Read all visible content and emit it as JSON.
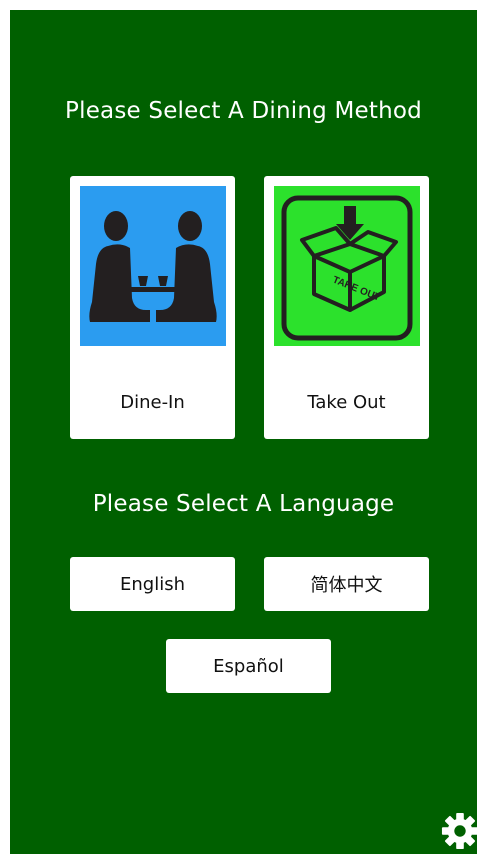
{
  "dining": {
    "title": "Please Select A Dining Method",
    "options": [
      {
        "label": "Dine-In",
        "icon": "dine-in-icon",
        "color": "#2b9cf0"
      },
      {
        "label": "Take Out",
        "icon": "take-out-box-icon",
        "color": "#2ce12c",
        "box_text": "TAKE OUT"
      }
    ]
  },
  "language": {
    "title": "Please Select A Language",
    "options": [
      {
        "label": "English"
      },
      {
        "label": "简体中文"
      },
      {
        "label": "Español"
      }
    ]
  },
  "settings": {
    "icon": "gear-icon"
  },
  "theme": {
    "background": "#006000",
    "card": "#ffffff",
    "text_on_card": "#111111"
  }
}
